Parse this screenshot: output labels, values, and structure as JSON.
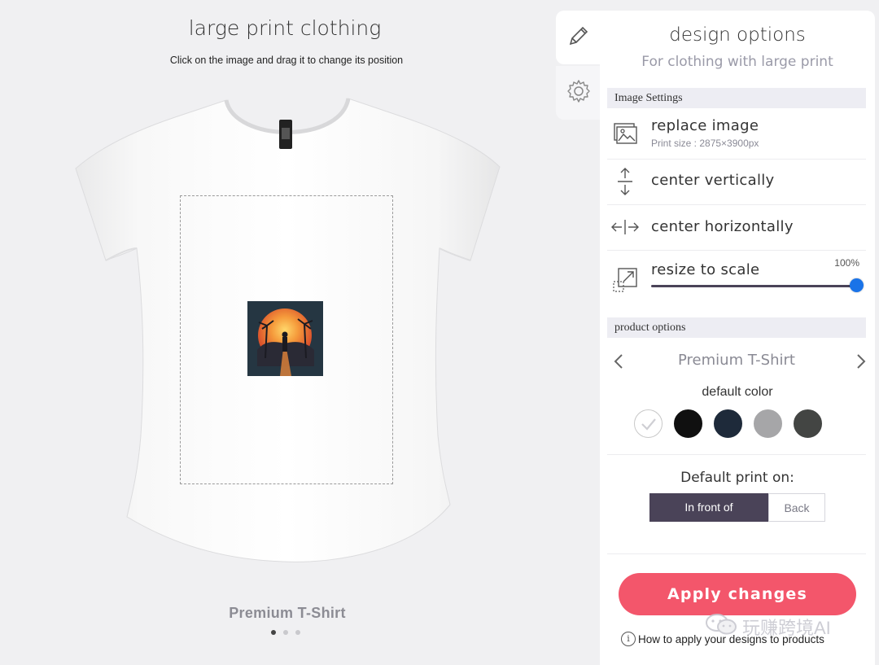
{
  "preview": {
    "title": "large print clothing",
    "hint": "Click on the image and drag it to change its position",
    "product_name": "Premium T-Shirt",
    "carousel": {
      "count": 3,
      "active": 0
    }
  },
  "tabs": {
    "edit_icon": "pencil-icon",
    "settings_icon": "gear-icon"
  },
  "panel": {
    "title": "design options",
    "subtitle": "For clothing with large print",
    "image_settings": {
      "header": "Image Settings",
      "replace": {
        "label": "replace image",
        "print_size": "Print size : 2875×3900px",
        "icon": "image-icon"
      },
      "center_v": {
        "label": "center vertically",
        "icon": "vertical-arrows-icon"
      },
      "center_h": {
        "label": "center horizontally",
        "icon": "horizontal-arrows-icon"
      },
      "resize": {
        "label": "resize to scale",
        "percent": "100%",
        "value": 1.0,
        "icon": "resize-icon"
      }
    },
    "product_options": {
      "header": "product options",
      "product": "Premium T-Shirt",
      "default_color_label": "default color",
      "colors": [
        "#ffffff",
        "#101010",
        "#1e2a3a",
        "#a6a6a8",
        "#434543"
      ],
      "selected_color": 0,
      "print_on_label": "Default print on:",
      "print_on": {
        "front": "In front of",
        "back": "Back",
        "selected": "front"
      }
    },
    "apply_button": "Apply changes",
    "howto_link": "How to apply your designs to products"
  },
  "watermark": "玩赚跨境AI",
  "colors": {
    "accent": "#f3566b",
    "dark": "#4a4358",
    "slider": "#1a73e8"
  }
}
